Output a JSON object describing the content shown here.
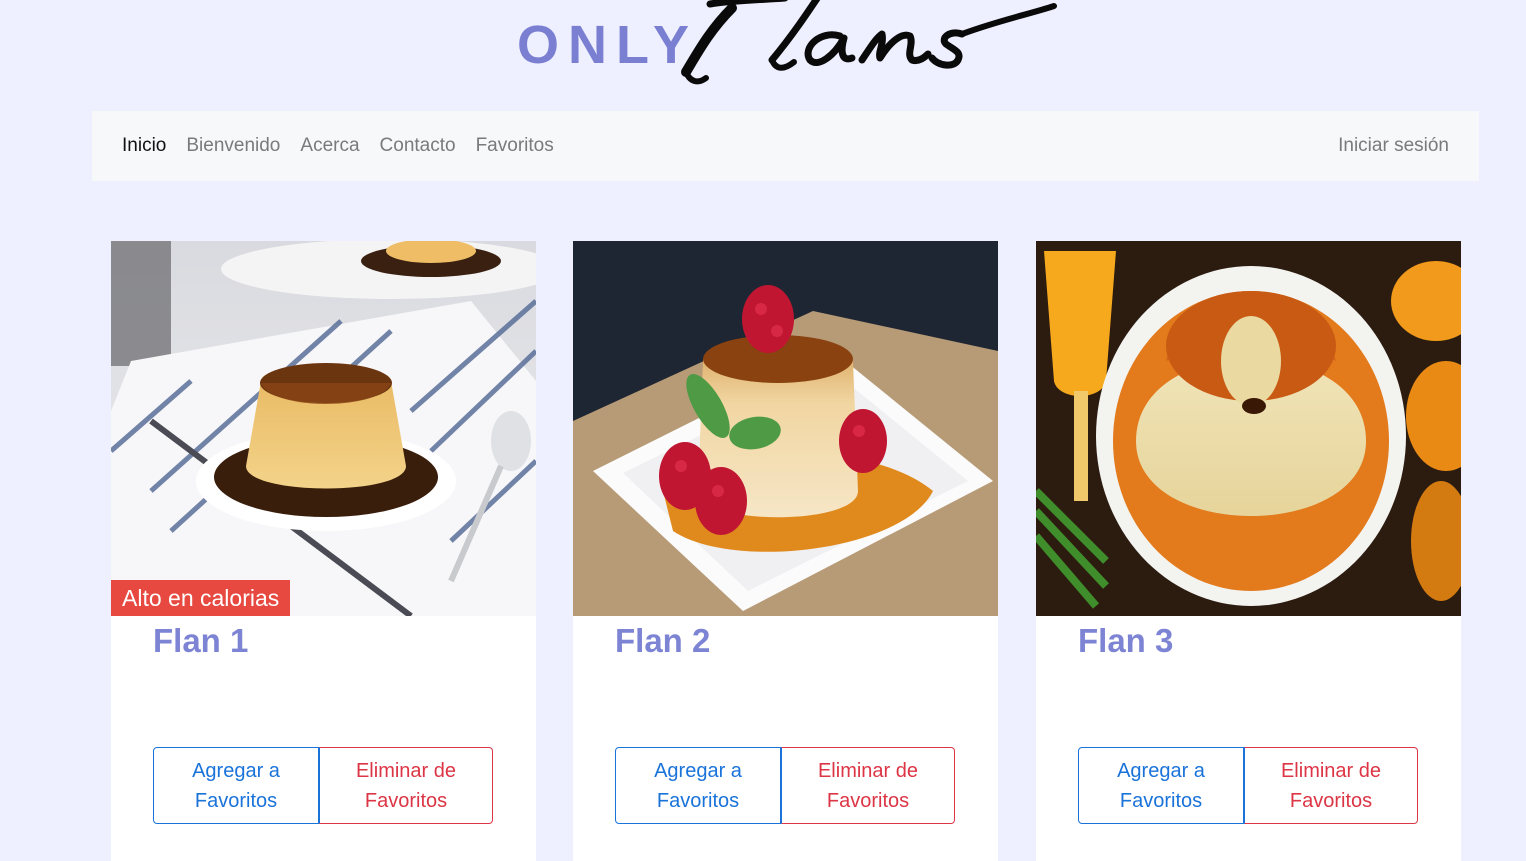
{
  "logo": {
    "only_text": "ONLY",
    "script_text": "Flans"
  },
  "navbar": {
    "links": [
      {
        "label": "Inicio",
        "active": true
      },
      {
        "label": "Bienvenido",
        "active": false
      },
      {
        "label": "Acerca",
        "active": false
      },
      {
        "label": "Contacto",
        "active": false
      },
      {
        "label": "Favoritos",
        "active": false
      }
    ],
    "login_label": "Iniciar sesión"
  },
  "cards": [
    {
      "title": "Flan 1",
      "badge": "Alto en calorias",
      "add_label": "Agregar a Favoritos",
      "remove_label": "Eliminar de Favoritos"
    },
    {
      "title": "Flan 2",
      "badge": "",
      "add_label": "Agregar a Favoritos",
      "remove_label": "Eliminar de Favoritos"
    },
    {
      "title": "Flan 3",
      "badge": "",
      "add_label": "Agregar a Favoritos",
      "remove_label": "Eliminar de Favoritos"
    }
  ],
  "colors": {
    "page_background": "#eef0ff",
    "brand_accent": "#7a7fd1",
    "title_color": "#7d84d4",
    "primary_outline": "#1a73d9",
    "danger_outline": "#dc3545",
    "badge_background": "#e7483f"
  }
}
